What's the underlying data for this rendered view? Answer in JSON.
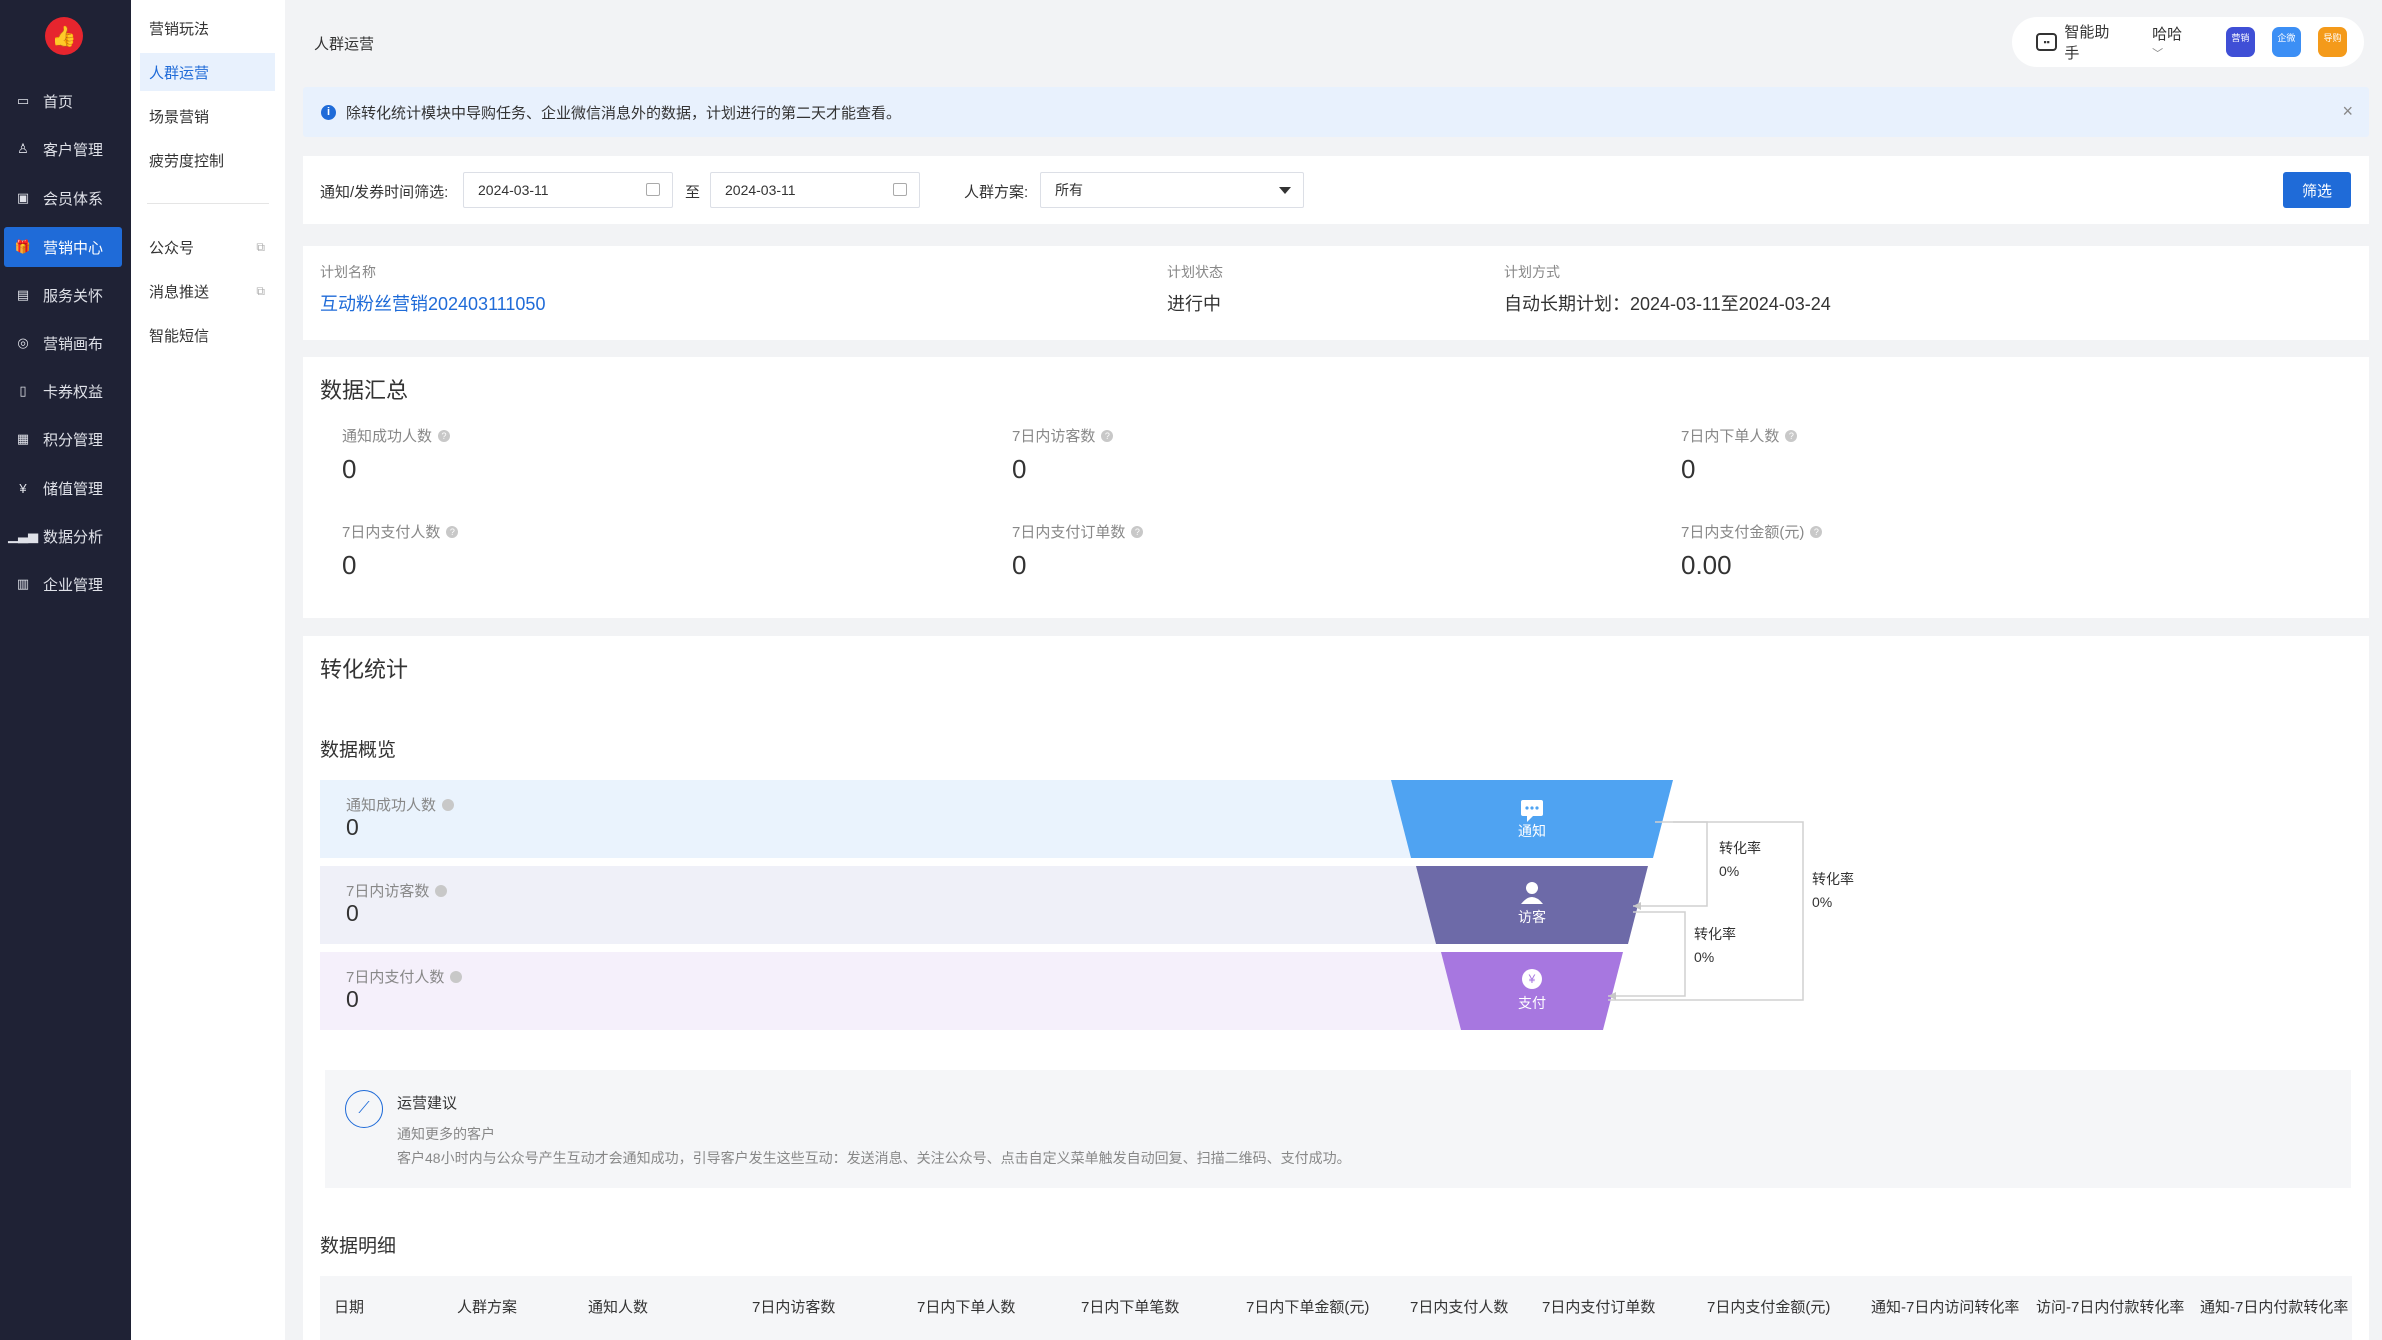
{
  "nav": {
    "logo_icon": "thumbs-up-icon",
    "items": [
      {
        "label": "首页",
        "icon": "home-icon"
      },
      {
        "label": "客户管理",
        "icon": "user-icon"
      },
      {
        "label": "会员体系",
        "icon": "vip-card-icon"
      },
      {
        "label": "营销中心",
        "icon": "gift-icon",
        "active": true
      },
      {
        "label": "服务关怀",
        "icon": "service-icon"
      },
      {
        "label": "营销画布",
        "icon": "canvas-icon"
      },
      {
        "label": "卡券权益",
        "icon": "coupon-icon"
      },
      {
        "label": "积分管理",
        "icon": "points-icon"
      },
      {
        "label": "储值管理",
        "icon": "yuan-icon"
      },
      {
        "label": "数据分析",
        "icon": "bar-chart-icon"
      },
      {
        "label": "企业管理",
        "icon": "building-icon"
      }
    ]
  },
  "subnav": {
    "items": [
      {
        "label": "营销玩法"
      },
      {
        "label": "人群运营",
        "active": true
      },
      {
        "label": "场景营销"
      },
      {
        "label": "疲劳度控制"
      },
      {
        "label": "公众号",
        "external": true
      },
      {
        "label": "消息推送",
        "external": true
      },
      {
        "label": "智能短信"
      }
    ]
  },
  "page_title": "人群运营",
  "topbar": {
    "assistant": "智能助手",
    "user": "哈哈",
    "apps": [
      {
        "label": "营销",
        "color": "#3f4fd6"
      },
      {
        "label": "企微",
        "color": "#3c8ff5"
      },
      {
        "label": "导购",
        "color": "#f49a1a"
      }
    ]
  },
  "notice": "除转化统计模块中导购任务、企业微信消息外的数据，计划进行的第二天才能查看。",
  "filter": {
    "time_label": "通知/发券时间筛选:",
    "start_date": "2024-03-11",
    "to": "至",
    "end_date": "2024-03-11",
    "crowd_label": "人群方案:",
    "crowd_value": "所有",
    "button": "筛选"
  },
  "plan": {
    "name_label": "计划名称",
    "name": "互动粉丝营销202403111050",
    "status_label": "计划状态",
    "status": "进行中",
    "mode_label": "计划方式",
    "mode": "自动长期计划：2024-03-11至2024-03-24"
  },
  "summary": {
    "title": "数据汇总",
    "metrics": [
      {
        "label": "通知成功人数",
        "value": "0"
      },
      {
        "label": "7日内访客数",
        "value": "0"
      },
      {
        "label": "7日内下单人数",
        "value": "0"
      },
      {
        "label": "7日内支付人数",
        "value": "0"
      },
      {
        "label": "7日内支付订单数",
        "value": "0"
      },
      {
        "label": "7日内支付金额(元)",
        "value": "0.00"
      }
    ]
  },
  "conversion": {
    "title": "转化统计",
    "overview_title": "数据概览",
    "bands": [
      {
        "label": "通知成功人数",
        "value": "0",
        "funnel_label": "通知",
        "icon": "message-icon",
        "color": "#4fa3f2",
        "bg": "#eaf3fd"
      },
      {
        "label": "7日内访客数",
        "value": "0",
        "funnel_label": "访客",
        "icon": "person-icon",
        "color": "#6d6aa8",
        "bg": "#eff0f8"
      },
      {
        "label": "7日内支付人数",
        "value": "0",
        "funnel_label": "支付",
        "icon": "yuan-coin-icon",
        "color": "#a777e0",
        "bg": "#f5f0fb"
      }
    ],
    "rates": [
      {
        "label": "转化率",
        "value": "0%"
      },
      {
        "label": "转化率",
        "value": "0%"
      },
      {
        "label": "转化率",
        "value": "0%"
      }
    ],
    "advice": {
      "title": "运营建议",
      "subtitle": "通知更多的客户",
      "detail": "客户48小时内与公众号产生互动才会通知成功，引导客户发生这些互动：发送消息、关注公众号、点击自定义菜单触发自动回复、扫描二维码、支付成功。"
    },
    "detail_title": "数据明细",
    "columns": [
      "日期",
      "人群方案",
      "通知人数",
      "7日内访客数",
      "7日内下单人数",
      "7日内下单笔数",
      "7日内下单金额(元)",
      "7日内支付人数",
      "7日内支付订单数",
      "7日内支付金额(元)",
      "通知-7日内访问转化率",
      "访问-7日内付款转化率",
      "通知-7日内付款转化率"
    ]
  }
}
